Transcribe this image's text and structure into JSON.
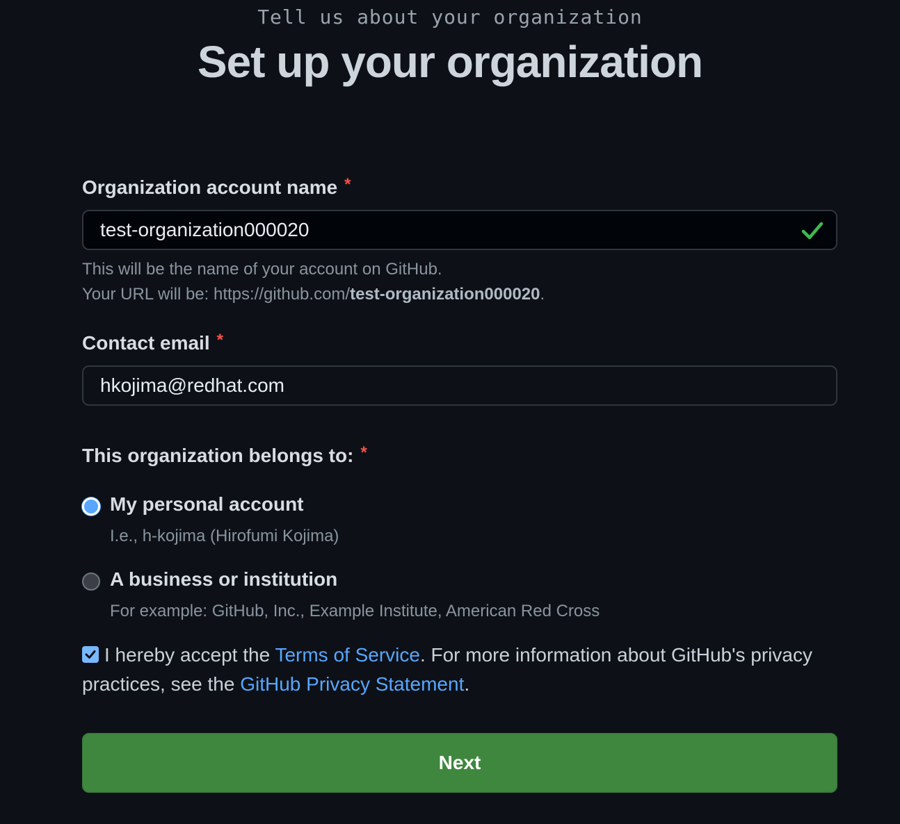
{
  "header": {
    "eyebrow": "Tell us about your organization",
    "title": "Set up your organization"
  },
  "org_name": {
    "label": "Organization account name",
    "required_mark": "*",
    "value": "test-organization000020",
    "valid": true,
    "help_line1": "This will be the name of your account on GitHub.",
    "help_url_prefix": "Your URL will be: https://github.com/",
    "help_url_slug": "test-organization000020",
    "help_url_suffix": "."
  },
  "contact_email": {
    "label": "Contact email",
    "required_mark": "*",
    "value": "hkojima@redhat.com"
  },
  "belongs_to": {
    "label": "This organization belongs to:",
    "required_mark": "*",
    "options": [
      {
        "label": "My personal account",
        "description": "I.e., h-kojima (Hirofumi Kojima)",
        "selected": true
      },
      {
        "label": "A business or institution",
        "description": "For example: GitHub, Inc., Example Institute, American Red Cross",
        "selected": false
      }
    ]
  },
  "terms": {
    "checked": true,
    "text_before": "I hereby accept the ",
    "tos_link": "Terms of Service",
    "text_middle": ". For more information about GitHub's privacy practices, see the ",
    "privacy_link": "GitHub Privacy Statement",
    "text_after": "."
  },
  "next_button": {
    "label": "Next",
    "color": "#3f873f"
  },
  "colors": {
    "background": "#0d1117",
    "required": "#f85149",
    "link": "#58a6ff",
    "valid_check": "#3fb950"
  },
  "icons": {
    "valid": "check-icon",
    "terms_checkbox": "checkbox-checked-icon"
  }
}
